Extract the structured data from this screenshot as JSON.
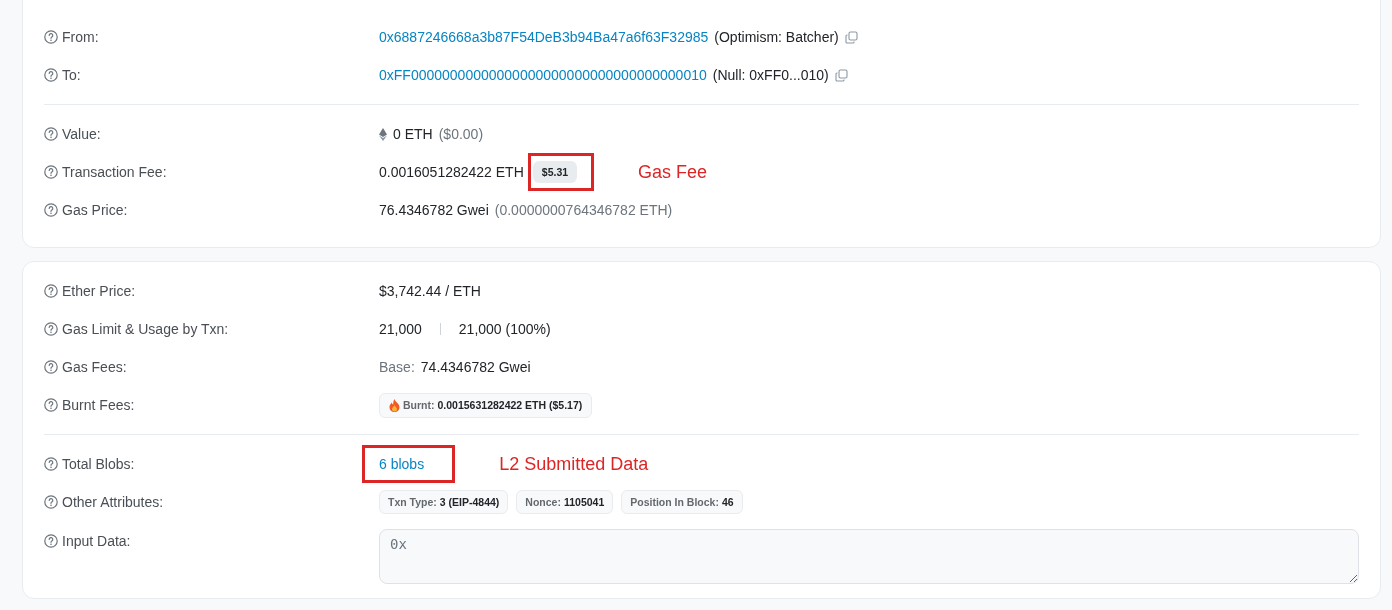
{
  "cards": [
    {
      "sections": [
        {
          "rows": [
            {
              "kind": "address",
              "label": "From:",
              "address": "0x6887246668a3b87F54DeB3b94Ba47a6f63F32985",
              "note": "(Optimism: Batcher)"
            },
            {
              "kind": "address",
              "label": "To:",
              "address": "0xFF00000000000000000000000000000000000010",
              "note": "(Null: 0xFF0...010)"
            }
          ]
        },
        {
          "rows": [
            {
              "kind": "amount",
              "label": "Value:",
              "amount": "0 ETH",
              "note": "($0.00)"
            },
            {
              "kind": "fee",
              "label": "Transaction Fee:",
              "amount": "0.0016051282422 ETH",
              "usd": "$5.31",
              "annotation": "Gas Fee"
            },
            {
              "kind": "text",
              "label": "Gas Price:",
              "text": "76.4346782 Gwei",
              "note": "(0.0000000764346782 ETH)"
            }
          ]
        }
      ]
    },
    {
      "sections": [
        {
          "rows": [
            {
              "kind": "text",
              "label": "Ether Price:",
              "text": "$3,742.44 / ETH"
            },
            {
              "kind": "usage",
              "label": "Gas Limit & Usage by Txn:",
              "limit": "21,000",
              "usage": "21,000 (100%)"
            },
            {
              "kind": "prefixed",
              "label": "Gas Fees:",
              "prefix": "Base:",
              "text": "74.4346782 Gwei"
            },
            {
              "kind": "burnt",
              "label": "Burnt Fees:",
              "prefix": "Burnt:",
              "text": "0.0015631282422 ETH ($5.17)"
            }
          ]
        },
        {
          "rows": [
            {
              "kind": "link",
              "label": "Total Blobs:",
              "link": "6 blobs",
              "annotation": "L2 Submitted Data"
            },
            {
              "kind": "badges",
              "label": "Other Attributes:",
              "badges": [
                {
                  "label": "Txn Type:",
                  "value": "3 (EIP-4844)"
                },
                {
                  "label": "Nonce:",
                  "value": "1105041"
                },
                {
                  "label": "Position In Block:",
                  "value": "46"
                }
              ]
            },
            {
              "kind": "input",
              "label": "Input Data:",
              "value": "0x"
            }
          ]
        }
      ]
    }
  ]
}
